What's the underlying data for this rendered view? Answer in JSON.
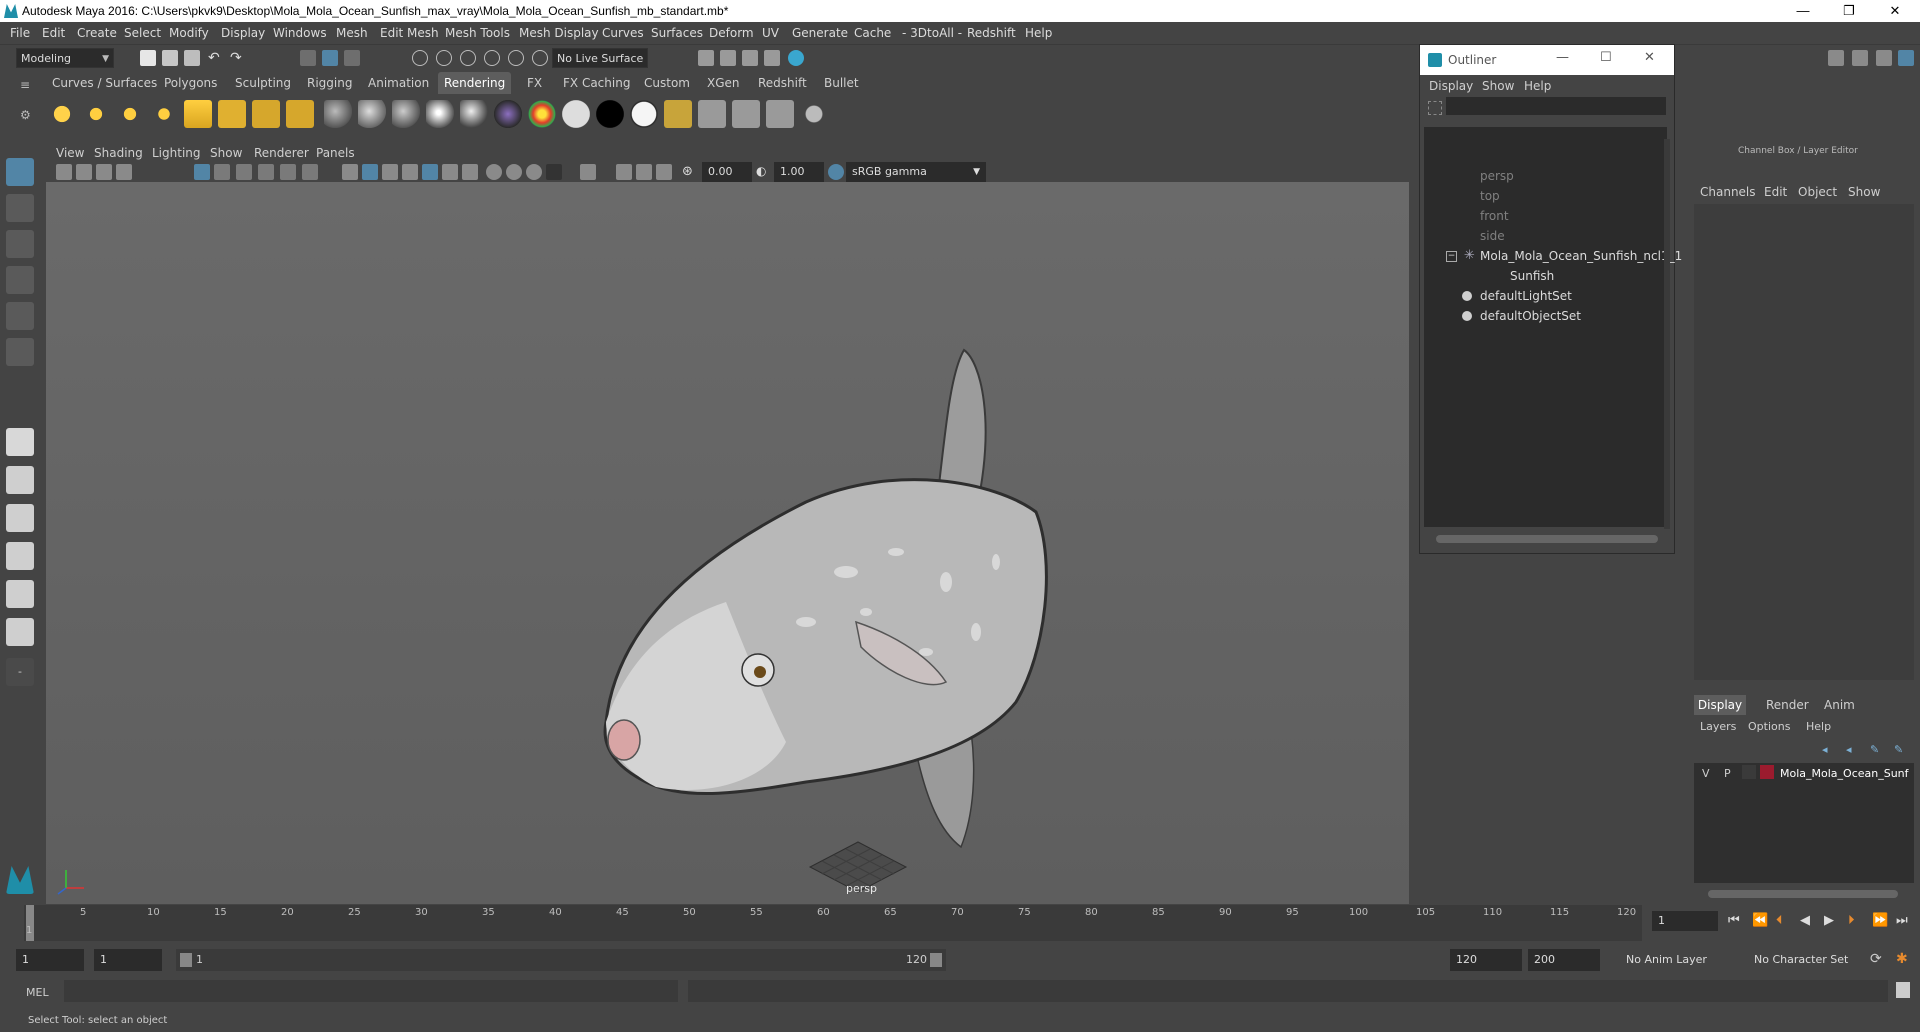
{
  "window": {
    "title": "Autodesk Maya 2016: C:\\Users\\pkvk9\\Desktop\\Mola_Mola_Ocean_Sunfish_max_vray\\Mola_Mola_Ocean_Sunfish_mb_standart.mb*",
    "minimize": "—",
    "maximize": "❐",
    "close": "✕"
  },
  "menu": [
    "File",
    "Edit",
    "Create",
    "Select",
    "Modify",
    "Display",
    "Windows",
    "Mesh",
    "Edit Mesh",
    "Mesh Tools",
    "Mesh Display",
    "Curves",
    "Surfaces",
    "Deform",
    "UV",
    "Generate",
    "Cache",
    "- 3DtoAll -",
    "Redshift",
    "Help"
  ],
  "status": {
    "mode": "Modeling",
    "live_surface": "No Live Surface"
  },
  "shelf_tabs": [
    "Curves / Surfaces",
    "Polygons",
    "Sculpting",
    "Rigging",
    "Animation",
    "Rendering",
    "FX",
    "FX Caching",
    "Custom",
    "XGen",
    "Redshift",
    "Bullet"
  ],
  "active_shelf_tab": "Rendering",
  "panel_menu": [
    "View",
    "Shading",
    "Lighting",
    "Show",
    "Renderer",
    "Panels"
  ],
  "panel_toolbar": {
    "exposure": "0.00",
    "gamma": "1.00",
    "color_space": "sRGB gamma"
  },
  "viewport": {
    "camera_label": "persp"
  },
  "outliner": {
    "title": "Outliner",
    "menu": [
      "Display",
      "Show",
      "Help"
    ],
    "items": [
      {
        "label": "persp",
        "dim": true
      },
      {
        "label": "top",
        "dim": true
      },
      {
        "label": "front",
        "dim": true
      },
      {
        "label": "side",
        "dim": true
      },
      {
        "label": "Mola_Mola_Ocean_Sunfish_ncl1_1",
        "dim": false
      },
      {
        "label": "Sunfish",
        "dim": false
      },
      {
        "label": "defaultLightSet",
        "dim": false
      },
      {
        "label": "defaultObjectSet",
        "dim": false
      }
    ]
  },
  "channel_box": {
    "title": "Channel Box / Layer Editor",
    "menu": [
      "Channels",
      "Edit",
      "Object",
      "Show"
    ]
  },
  "layer_editor": {
    "tabs": [
      "Display",
      "Render",
      "Anim"
    ],
    "menu": [
      "Layers",
      "Options",
      "Help"
    ],
    "layer": {
      "v": "V",
      "p": "P",
      "name": "Mola_Mola_Ocean_Sunf",
      "color": "#9b1b2e"
    }
  },
  "timeline": {
    "ticks": [
      "1",
      "5",
      "10",
      "15",
      "20",
      "25",
      "30",
      "35",
      "40",
      "45",
      "50",
      "55",
      "60",
      "65",
      "70",
      "75",
      "80",
      "85",
      "90",
      "95",
      "100",
      "105",
      "110",
      "115",
      "120"
    ],
    "current_frame": "1"
  },
  "range": {
    "start": "1",
    "start2": "1",
    "slider_start": "1",
    "slider_end": "120",
    "end": "120",
    "end2": "200",
    "anim_layer": "No Anim Layer",
    "char_set": "No Character Set"
  },
  "cmd": {
    "label": "MEL"
  },
  "help": {
    "text": "Select Tool: select an object"
  },
  "colors": {
    "accent": "#5285a6",
    "bg": "#444444",
    "viewport": "#646464"
  }
}
